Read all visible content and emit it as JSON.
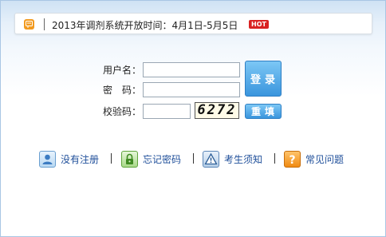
{
  "notice": {
    "text": "2013年调剂系统开放时间：4月1日-5月5日",
    "badge": "HOT"
  },
  "form": {
    "username_label": "用户名：",
    "password_label": "密　码：",
    "captcha_label": "校验码：",
    "username_value": "",
    "password_value": "",
    "captcha_value": "",
    "captcha_image_text": "6272",
    "login_button": "登录",
    "reset_button": "重填"
  },
  "links": [
    {
      "label": "没有注册",
      "icon": "user-icon"
    },
    {
      "label": "忘记密码",
      "icon": "lock-icon"
    },
    {
      "label": "考生须知",
      "icon": "warning-icon"
    },
    {
      "label": "常见问题",
      "icon": "help-icon"
    }
  ],
  "colors": {
    "accent": "#3a95dd",
    "link": "#1f4f9a",
    "badge": "#d92121",
    "notice_icon": "#f29a1f"
  }
}
